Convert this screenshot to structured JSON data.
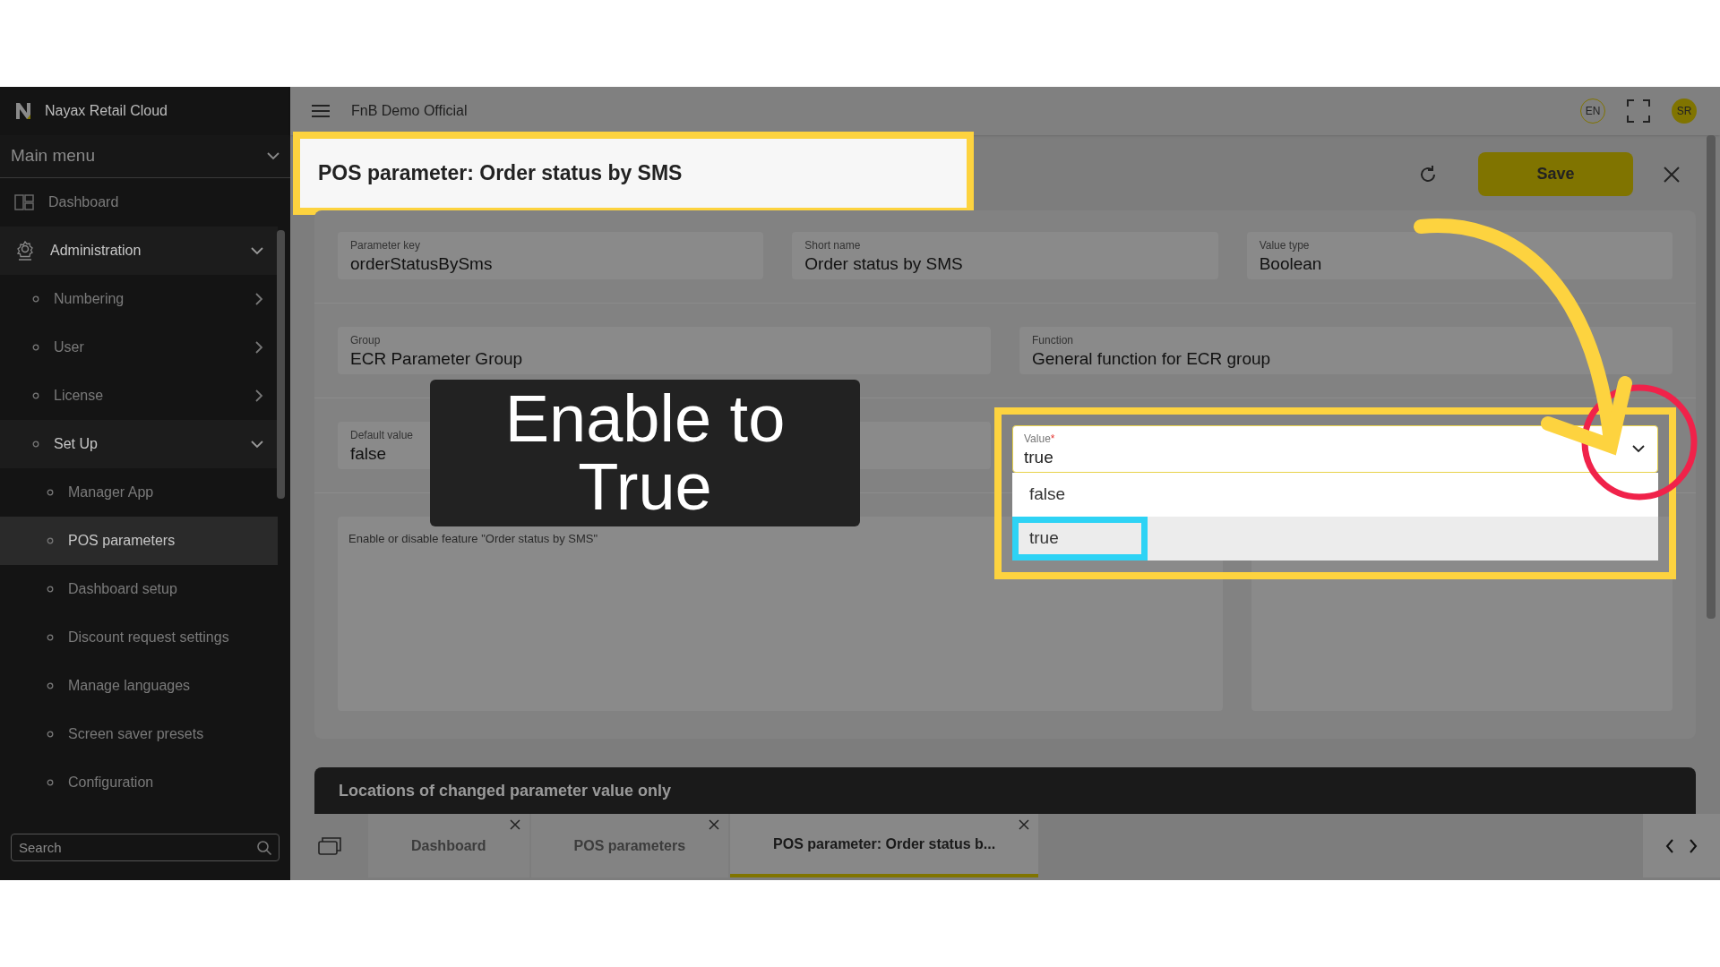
{
  "sidebar": {
    "brand": "Nayax Retail Cloud",
    "section": "Main menu",
    "items": [
      {
        "label": "Dashboard",
        "kind": "dashboard",
        "selected": false
      },
      {
        "label": "Administration",
        "kind": "gear",
        "selected": false,
        "expanded": true,
        "children": [
          {
            "label": "Numbering",
            "selected": false,
            "expanded": false
          },
          {
            "label": "User",
            "selected": false,
            "expanded": false
          },
          {
            "label": "License",
            "selected": false,
            "expanded": false
          },
          {
            "label": "Set Up",
            "selected": false,
            "expanded": true,
            "children": [
              {
                "label": "Manager App",
                "selected": false
              },
              {
                "label": "POS parameters",
                "selected": true
              },
              {
                "label": "Dashboard setup",
                "selected": false
              },
              {
                "label": "Discount request settings",
                "selected": false
              },
              {
                "label": "Manage languages",
                "selected": false
              },
              {
                "label": "Screen saver presets",
                "selected": false
              },
              {
                "label": "Configuration",
                "selected": false
              }
            ]
          }
        ]
      }
    ],
    "search": {
      "placeholder": "Search"
    }
  },
  "header": {
    "workspace": "FnB Demo Official",
    "language": "EN",
    "avatar": "SR"
  },
  "page": {
    "title": "POS parameter: Order status by SMS",
    "save": "Save",
    "fields": [
      {
        "label": "Parameter key",
        "value": "orderStatusBySms"
      },
      {
        "label": "Short name",
        "value": "Order status by SMS"
      },
      {
        "label": "Value type",
        "value": "Boolean"
      },
      {
        "label": "Group",
        "value": "ECR Parameter Group"
      },
      {
        "label": "Function",
        "value": "General function for ECR group"
      },
      {
        "label": "Default value",
        "value": "false"
      }
    ],
    "value_select": {
      "label": "Value",
      "required_mark": "*",
      "value": "true",
      "options": [
        {
          "label": "false",
          "selected": false
        },
        {
          "label": "true",
          "selected": true
        }
      ]
    },
    "description": "Enable or disable feature \"Order status by SMS\""
  },
  "locations_panel": {
    "title": "Locations of changed parameter value only"
  },
  "tabs": [
    {
      "label": "Dashboard",
      "selected": false
    },
    {
      "label": "POS parameters",
      "selected": false
    },
    {
      "label": "POS parameter: Order status b...",
      "selected": true
    }
  ],
  "annotation": {
    "caption": "Enable to True"
  }
}
